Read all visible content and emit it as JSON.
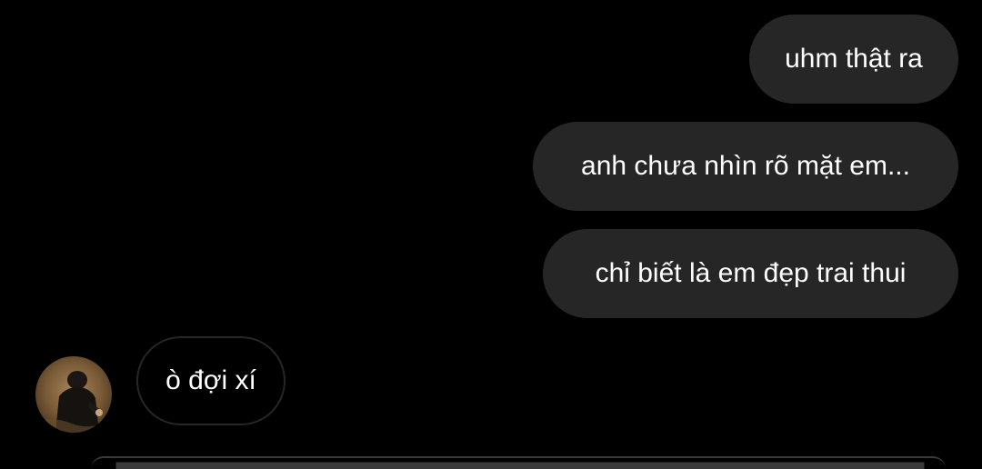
{
  "chat": {
    "messages": [
      {
        "direction": "outgoing",
        "text": "uhm thật ra"
      },
      {
        "direction": "outgoing",
        "text": "anh chưa nhìn rõ mặt em..."
      },
      {
        "direction": "outgoing",
        "text": "chỉ biết là em đẹp trai thui"
      },
      {
        "direction": "incoming",
        "text": "ò đợi xí"
      }
    ],
    "sender_avatar_icon": "person-photo-avatar"
  },
  "colors": {
    "background": "#000000",
    "outgoing_bubble": "#262626",
    "incoming_bubble_border": "#262626",
    "text": "#ffffff"
  }
}
